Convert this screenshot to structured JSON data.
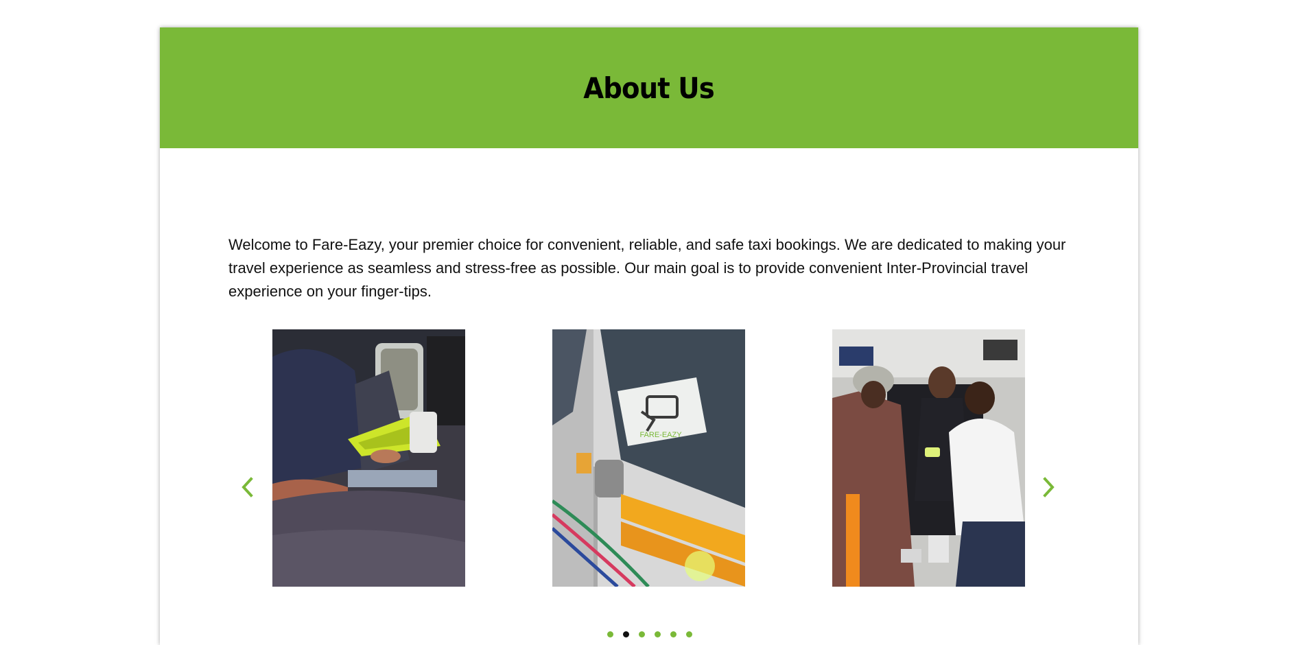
{
  "header": {
    "title": "About Us",
    "background_color": "#7ab938"
  },
  "intro": {
    "text": "Welcome to Fare-Eazy, your premier choice for convenient, reliable, and safe taxi bookings. We are dedicated to making your travel experience as seamless and stress-free as possible. Our main goal is to provide convenient Inter-Provincial travel experience on your finger-tips."
  },
  "carousel": {
    "prev_icon": "chevron-left-icon",
    "next_icon": "chevron-right-icon",
    "accent_color": "#7ab938",
    "slides": [
      {
        "name": "card-machine-photo",
        "logo_text": ""
      },
      {
        "name": "taxi-door-sticker-photo",
        "logo_text": "FARE-EAZY"
      },
      {
        "name": "people-in-taxi-photo",
        "logo_text": ""
      }
    ],
    "dot_count": 6,
    "active_dot": 1
  }
}
